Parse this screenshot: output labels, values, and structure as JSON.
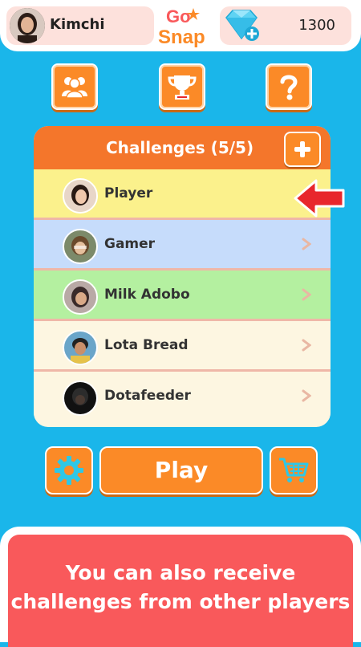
{
  "header": {
    "username": "Kimchi",
    "logo_line1": "Go",
    "logo_line2": "Snap",
    "gem_count": "1300"
  },
  "nav": {
    "friends_icon": "friends-icon",
    "trophy_icon": "trophy-icon",
    "help_icon": "question-mark-icon"
  },
  "challenges": {
    "title": "Challenges  (5/5)",
    "add_icon": "plus-icon",
    "items": [
      {
        "name": "Player",
        "color": "#fbf18c"
      },
      {
        "name": "Gamer",
        "color": "#c6dcfb"
      },
      {
        "name": "Milk Adobo",
        "color": "#b4f0a0"
      },
      {
        "name": "Lota Bread",
        "color": "#fdf6e1"
      },
      {
        "name": "Dotafeeder",
        "color": "#fdf6e1"
      }
    ]
  },
  "actions": {
    "play_label": "Play",
    "settings_icon": "gear-icon",
    "cart_icon": "cart-icon"
  },
  "tip": {
    "line1": "You can also receive",
    "line2": "challenges from other players"
  },
  "colors": {
    "background": "#1ab6ea",
    "accent": "#fb8a27",
    "header_orange": "#f4762b",
    "tip_red": "#f9595b",
    "arrow_red": "#e8272c"
  }
}
